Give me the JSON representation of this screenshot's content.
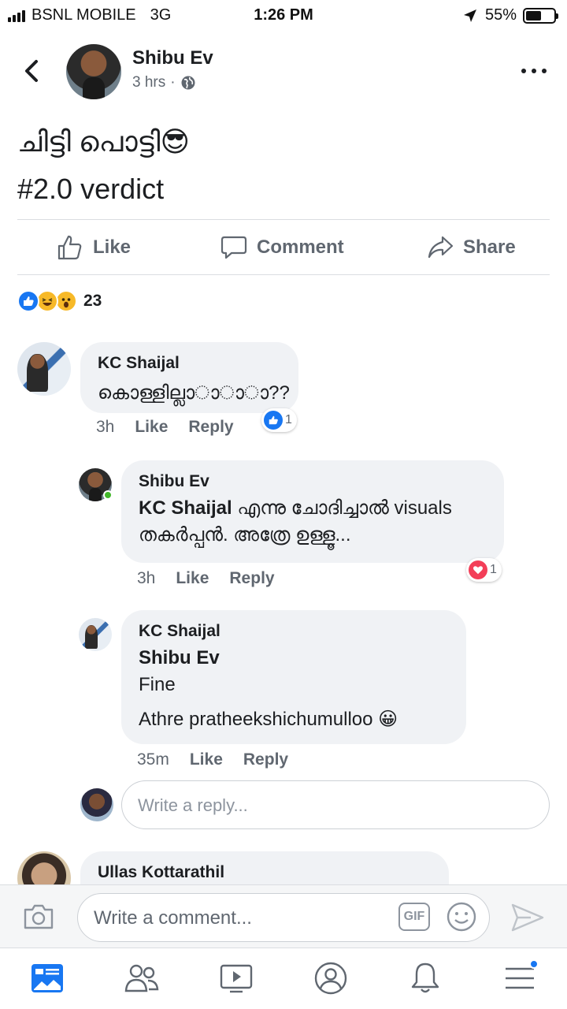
{
  "status_bar": {
    "carrier": "BSNL MOBILE",
    "network": "3G",
    "time": "1:26 PM",
    "battery": "55%",
    "battery_level": 0.55
  },
  "post": {
    "author": "Shibu Ev",
    "time": "3 hrs",
    "text_line1": "ചിട്ടി പൊട്ടി😎",
    "text_line2": "#2.0 verdict",
    "privacy_icon": "globe-icon"
  },
  "actions": {
    "like": "Like",
    "comment": "Comment",
    "share": "Share"
  },
  "reactions": {
    "count": "23",
    "types": [
      "like",
      "haha",
      "wow"
    ]
  },
  "comments": [
    {
      "author": "KC Shaijal",
      "text": "കൊള്ളില്ലാ◌ാ◌ാ◌ാ??",
      "time": "3h",
      "like": "Like",
      "reply": "Reply",
      "reaction_count": "1",
      "reaction": "like"
    },
    {
      "author": "Shibu Ev",
      "mention": "KC Shaijal",
      "text_after_mention": " എന്നു ചോദിച്ചാൽ visuals",
      "text_line2": "തകർപ്പൻ. അത്രേ ഉള്ളൂ...",
      "time": "3h",
      "like": "Like",
      "reply": "Reply",
      "reaction_count": "1",
      "reaction": "love"
    },
    {
      "author": "KC Shaijal",
      "mention": "Shibu Ev",
      "line2": "Fine",
      "line3": "Athre pratheekshichumulloo 😀",
      "time": "35m",
      "like": "Like",
      "reply": "Reply"
    }
  ],
  "reply_input": {
    "placeholder": "Write a reply..."
  },
  "next_comment": {
    "author": "Ullas Kottarathil"
  },
  "comment_bar": {
    "placeholder": "Write a comment...",
    "gif_label": "GIF"
  },
  "tabs": [
    "news-feed",
    "friends",
    "watch",
    "profile",
    "notifications",
    "menu"
  ],
  "colors": {
    "accent": "#1877f2",
    "love": "#f33e58",
    "bubble": "#f0f2f5",
    "secondary_text": "#606770"
  }
}
